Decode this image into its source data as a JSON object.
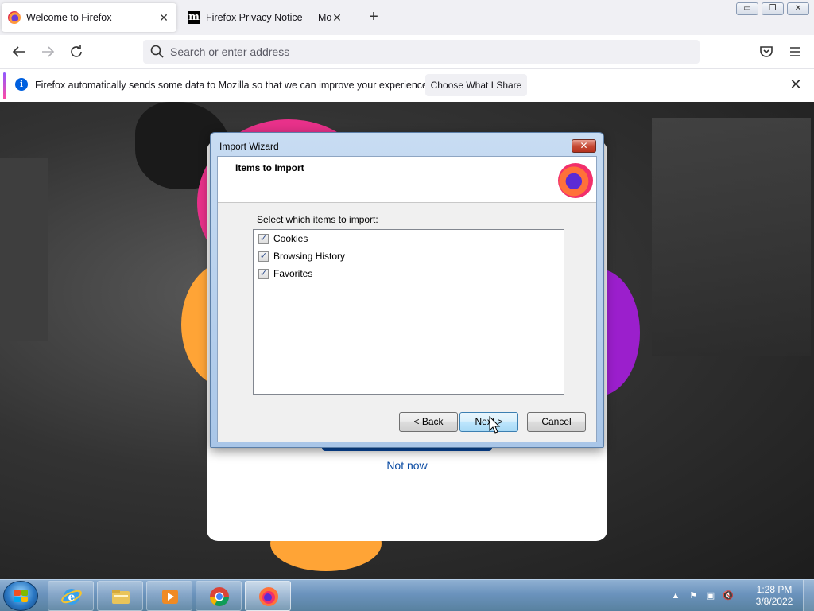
{
  "tabs": [
    {
      "title": "Welcome to Firefox",
      "favicon": "firefox-icon",
      "active": true
    },
    {
      "title": "Firefox Privacy Notice — Mozilla",
      "favicon": "mozilla-icon",
      "active": false
    }
  ],
  "window_controls": {
    "minimize": "▭",
    "restore": "❐",
    "close": "✕"
  },
  "navbar": {
    "back_icon": "arrow-left-icon",
    "forward_icon": "arrow-right-icon",
    "reload_icon": "reload-icon",
    "address_placeholder": "Search or enter address",
    "pocket_icon": "pocket-icon",
    "menu_icon": "hamburger-menu-icon"
  },
  "notification": {
    "message": "Firefox automatically sends some data to Mozilla so that we can improve your experience.",
    "button_label": "Choose What I Share"
  },
  "welcome": {
    "not_now_label": "Not now"
  },
  "import_wizard": {
    "window_title": "Import Wizard",
    "header_title": "Items to Import",
    "prompt": "Select which items to import:",
    "items": [
      {
        "label": "Cookies",
        "checked": true
      },
      {
        "label": "Browsing History",
        "checked": true
      },
      {
        "label": "Favorites",
        "checked": true
      }
    ],
    "buttons": {
      "back": "< Back",
      "next": "Next >",
      "cancel": "Cancel"
    }
  },
  "taskbar": {
    "apps": [
      {
        "name": "internet-explorer",
        "state": "pinned"
      },
      {
        "name": "windows-explorer",
        "state": "pinned"
      },
      {
        "name": "media-player",
        "state": "pinned"
      },
      {
        "name": "chrome",
        "state": "pinned"
      },
      {
        "name": "firefox",
        "state": "active"
      }
    ],
    "clock": {
      "time": "1:28 PM",
      "date": "3/8/2022"
    }
  },
  "colors": {
    "accent_blue": "#0060df",
    "link_blue": "#0a4ba3",
    "blob_pink": "#e8318a",
    "blob_orange": "#ffa436",
    "blob_purple": "#9b1fcc"
  }
}
